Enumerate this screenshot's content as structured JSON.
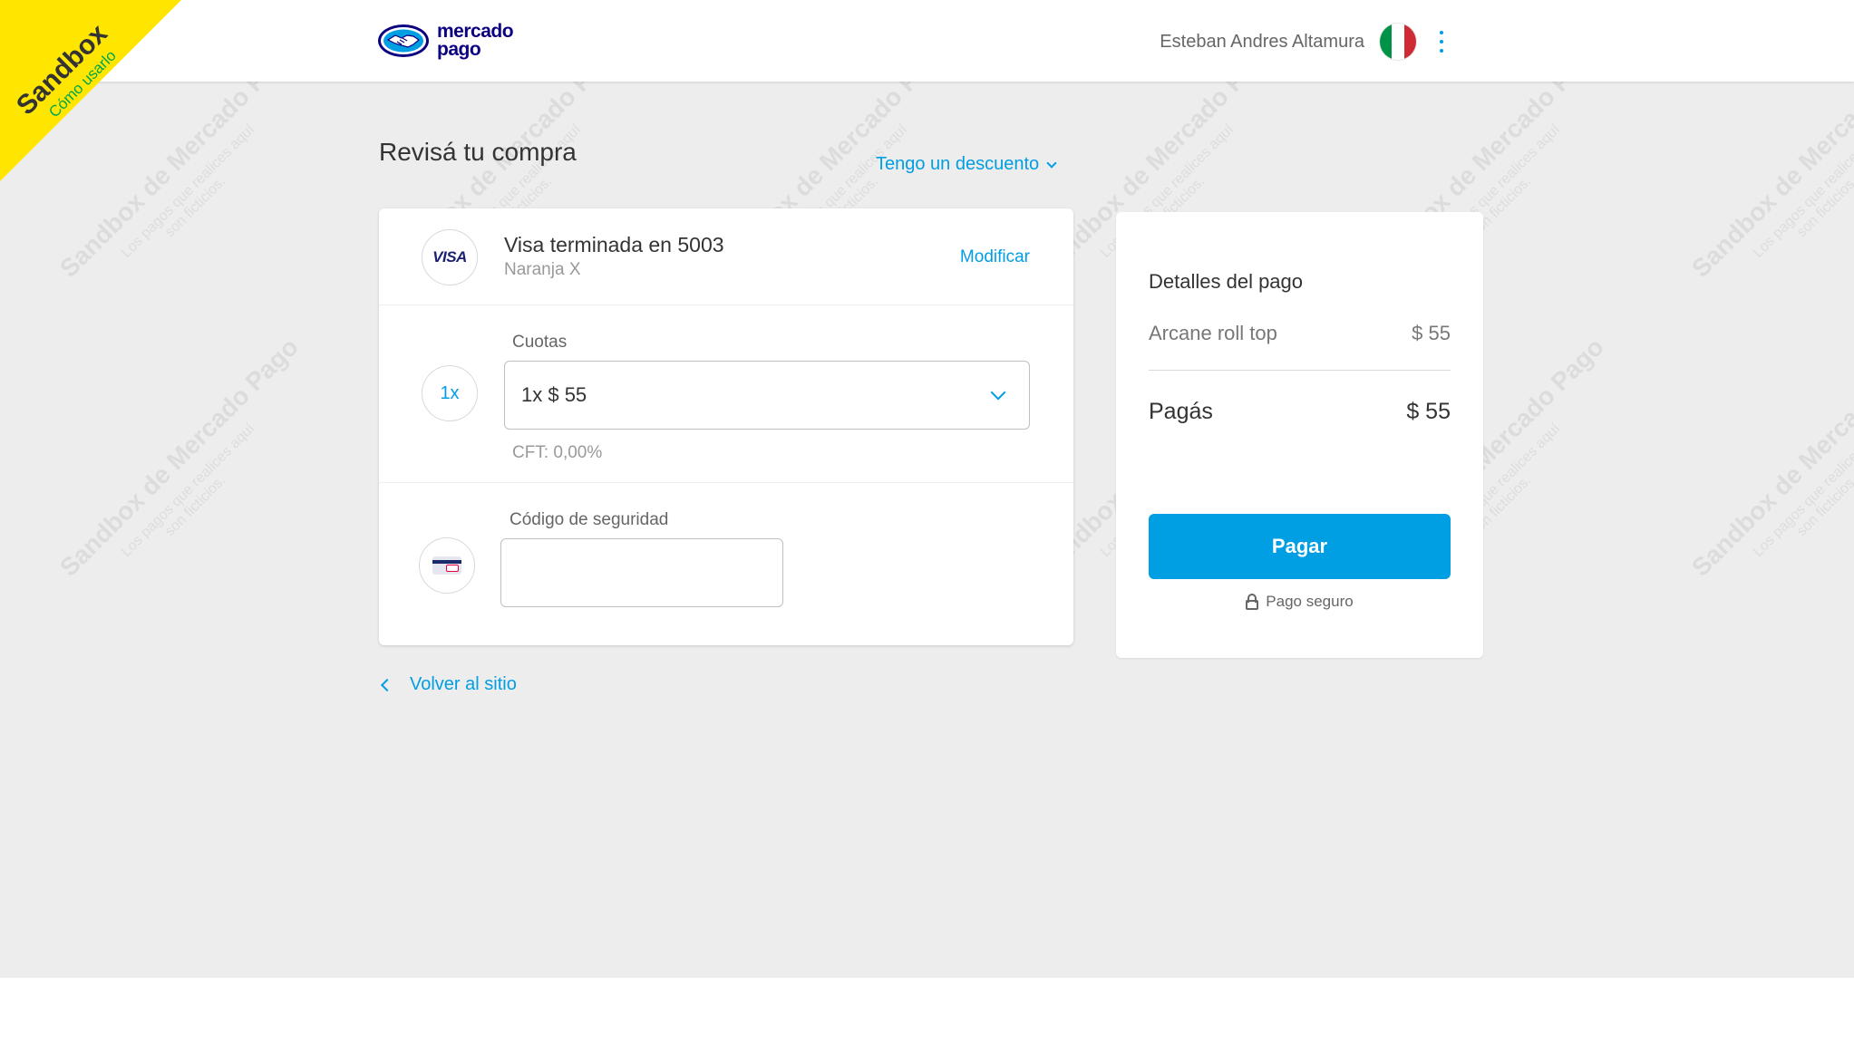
{
  "sandbox": {
    "title": "Sandbox",
    "link": "Cómo usarlo"
  },
  "header": {
    "logo_line1": "mercado",
    "logo_line2": "pago",
    "user_name": "Esteban Andres Altamura",
    "flag_colors": [
      "#009246",
      "#ffffff",
      "#ce2b37"
    ]
  },
  "watermark": {
    "title": "Sandbox de Mercado Pago",
    "subtitle_line1": "Los pagos que realices aquí",
    "subtitle_line2": "son ficticios."
  },
  "main": {
    "title": "Revisá tu compra",
    "discount_label": "Tengo un descuento",
    "payment_method": {
      "icon": "visa-icon",
      "brand_text": "VISA",
      "title": "Visa terminada en 5003",
      "issuer": "Naranja X",
      "modify_label": "Modificar"
    },
    "installments": {
      "badge": "1x",
      "label": "Cuotas",
      "selected": "1x $ 55",
      "cft": "CFT: 0,00%"
    },
    "security_code": {
      "label": "Código de seguridad",
      "value": "",
      "icon": "card-cvv-icon"
    },
    "back_label": "Volver al sitio"
  },
  "summary": {
    "title": "Detalles del pago",
    "item_name": "Arcane roll top",
    "item_price": "$ 55",
    "total_label": "Pagás",
    "total_price": "$ 55",
    "pay_button": "Pagar",
    "secure_label": "Pago seguro"
  },
  "colors": {
    "accent": "#009ee3",
    "sandbox_yellow": "#ffe600",
    "sandbox_green": "#00a650",
    "brand_navy": "#0a0080",
    "background": "#ededed"
  }
}
